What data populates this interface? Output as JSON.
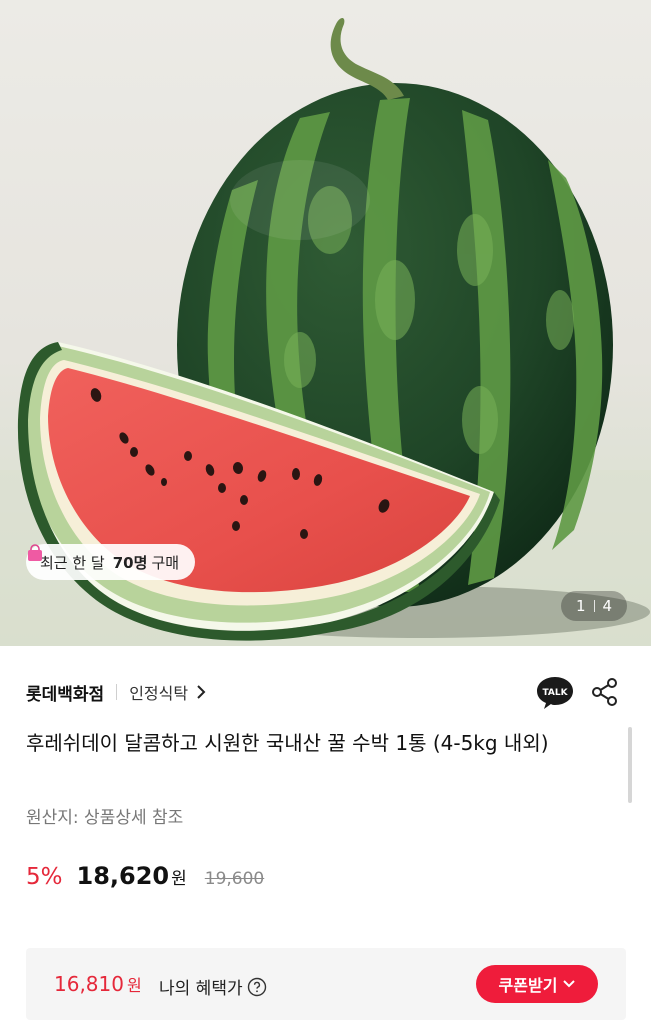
{
  "hero": {
    "badge_prefix": "최근 한 달",
    "badge_count": "70명",
    "badge_suffix": "구매",
    "pager_current": "1",
    "pager_total": "4"
  },
  "seller": {
    "brand": "롯데백화점",
    "category": "인정식탁",
    "talk_label": "TALK"
  },
  "product": {
    "title": "후레쉬데이 달콤하고 시원한 국내산 꿀 수박 1통 (4-5kg 내외)",
    "origin": "원산지: 상품상세 참조"
  },
  "price": {
    "discount": "5%",
    "sale_price": "18,620",
    "currency": "원",
    "original_price": "19,600"
  },
  "benefit": {
    "price": "16,810",
    "currency": "원",
    "label": "나의 혜택가",
    "coupon_label": "쿠폰받기"
  },
  "colors": {
    "accent": "#e5283a",
    "coupon_bg": "#ef1c3b"
  }
}
